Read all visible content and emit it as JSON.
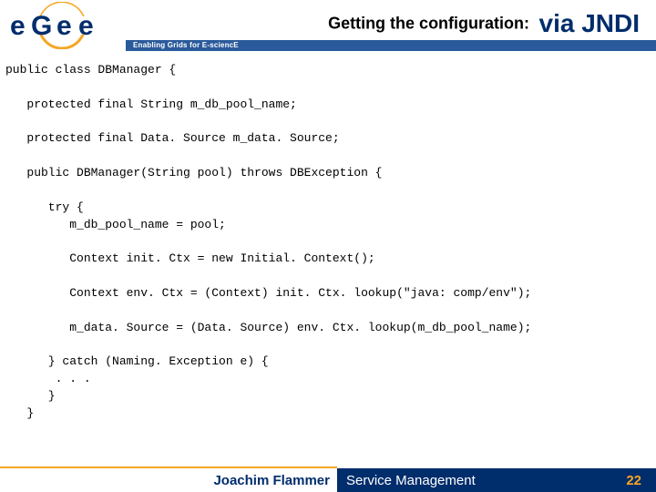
{
  "header": {
    "title_prefix": "Getting the configuration:",
    "title_accent": "via JNDI",
    "tagline": "Enabling Grids for E-sciencE"
  },
  "logo": {
    "text_e1": "e",
    "text_g": "G",
    "text_e2": "e",
    "text_e3": "e"
  },
  "code": {
    "l0": "public class DBManager {",
    "l1": "",
    "l2": "   protected final String m_db_pool_name;",
    "l3": "",
    "l4": "   protected final Data. Source m_data. Source;",
    "l5": "",
    "l6": "   public DBManager(String pool) throws DBException {",
    "l7": "",
    "l8": "      try {",
    "l9": "         m_db_pool_name = pool;",
    "l10": "",
    "l11": "         Context init. Ctx = new Initial. Context();",
    "l12": "",
    "l13": "         Context env. Ctx = (Context) init. Ctx. lookup(\"java: comp/env\");",
    "l14": "",
    "l15": "         m_data. Source = (Data. Source) env. Ctx. lookup(m_db_pool_name);",
    "l16": "",
    "l17": "      } catch (Naming. Exception e) {",
    "l18": "       . . .",
    "l19": "      }",
    "l20": "   }"
  },
  "footer": {
    "author": "Joachim Flammer",
    "topic": "Service Management",
    "page": "22"
  }
}
